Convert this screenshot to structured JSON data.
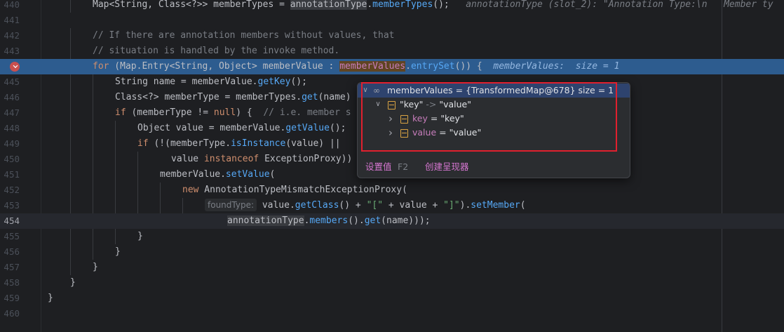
{
  "editor": {
    "lines": [
      {
        "n": "440",
        "indent": 2,
        "mode": "plain",
        "tokens": [
          {
            "t": "Map<String, Class<?>> memberTypes = "
          },
          {
            "t": "annotationType",
            "c": "hl"
          },
          {
            "t": "."
          },
          {
            "t": "memberTypes",
            "c": "fn"
          },
          {
            "t": "();   "
          },
          {
            "t": "annotationType (slot_2): \"Annotation Type:\\n   Member ty",
            "c": "inlay"
          }
        ]
      },
      {
        "n": "441",
        "indent": 0,
        "mode": "plain",
        "tokens": []
      },
      {
        "n": "442",
        "indent": 2,
        "mode": "plain",
        "tokens": [
          {
            "t": "// If there are annotation members without values, that",
            "c": "cm"
          }
        ]
      },
      {
        "n": "443",
        "indent": 2,
        "mode": "plain",
        "tokens": [
          {
            "t": "// situation is handled by the invoke method.",
            "c": "cm"
          }
        ]
      },
      {
        "n": "444",
        "indent": 2,
        "mode": "exec",
        "tokens": [
          {
            "t": "for",
            "c": "kw"
          },
          {
            "t": " (Map.Entry<String, Object> memberValue : "
          },
          {
            "t": "memberValues",
            "c": "fld hl-orange"
          },
          {
            "t": "."
          },
          {
            "t": "entrySet",
            "c": "fn"
          },
          {
            "t": "()) {  "
          },
          {
            "t": "memberValues:  size = 1",
            "c": "inlay-exec"
          }
        ]
      },
      {
        "n": "445",
        "indent": 3,
        "mode": "plain",
        "tokens": [
          {
            "t": "String name = memberValue."
          },
          {
            "t": "getKey",
            "c": "fn"
          },
          {
            "t": "();"
          }
        ]
      },
      {
        "n": "446",
        "indent": 3,
        "mode": "plain",
        "tokens": [
          {
            "t": "Class<?> memberType = memberTypes."
          },
          {
            "t": "get",
            "c": "fn"
          },
          {
            "t": "(name)"
          }
        ]
      },
      {
        "n": "447",
        "indent": 3,
        "mode": "plain",
        "tokens": [
          {
            "t": "if",
            "c": "kw"
          },
          {
            "t": " (memberType != "
          },
          {
            "t": "null",
            "c": "kw"
          },
          {
            "t": ") {  "
          },
          {
            "t": "// i.e. member s",
            "c": "cm"
          }
        ]
      },
      {
        "n": "448",
        "indent": 4,
        "mode": "plain",
        "tokens": [
          {
            "t": "Object value = memberValue."
          },
          {
            "t": "getValue",
            "c": "fn"
          },
          {
            "t": "();"
          }
        ]
      },
      {
        "n": "449",
        "indent": 4,
        "mode": "plain",
        "tokens": [
          {
            "t": "if",
            "c": "kw"
          },
          {
            "t": " (!(memberType."
          },
          {
            "t": "isInstance",
            "c": "fn"
          },
          {
            "t": "(value) ||"
          }
        ]
      },
      {
        "n": "450",
        "indent": 5.5,
        "mode": "plain",
        "tokens": [
          {
            "t": "value "
          },
          {
            "t": "instanceof",
            "c": "kw"
          },
          {
            "t": " ExceptionProxy))"
          }
        ]
      },
      {
        "n": "451",
        "indent": 5,
        "mode": "plain",
        "tokens": [
          {
            "t": "memberValue."
          },
          {
            "t": "setValue",
            "c": "fn"
          },
          {
            "t": "("
          }
        ]
      },
      {
        "n": "452",
        "indent": 6,
        "mode": "plain",
        "tokens": [
          {
            "t": "new",
            "c": "kw"
          },
          {
            "t": " AnnotationTypeMismatchExceptionProxy("
          }
        ]
      },
      {
        "n": "453",
        "indent": 7,
        "mode": "plain",
        "tokens": [
          {
            "t": "foundType:",
            "c": "hint"
          },
          {
            "t": " value."
          },
          {
            "t": "getClass",
            "c": "fn"
          },
          {
            "t": "() + "
          },
          {
            "t": "\"[\"",
            "c": "str"
          },
          {
            "t": " + value + "
          },
          {
            "t": "\"]\"",
            "c": "str"
          },
          {
            "t": ")."
          },
          {
            "t": "setMember",
            "c": "fn"
          },
          {
            "t": "("
          }
        ]
      },
      {
        "n": "454",
        "indent": 8,
        "mode": "current",
        "tokens": [
          {
            "t": "annotationType",
            "c": "hl"
          },
          {
            "t": "."
          },
          {
            "t": "members",
            "c": "fn"
          },
          {
            "t": "()."
          },
          {
            "t": "get",
            "c": "fn"
          },
          {
            "t": "(name)));"
          }
        ]
      },
      {
        "n": "455",
        "indent": 4,
        "mode": "plain",
        "tokens": [
          {
            "t": "}"
          }
        ]
      },
      {
        "n": "456",
        "indent": 3,
        "mode": "plain",
        "tokens": [
          {
            "t": "}"
          }
        ]
      },
      {
        "n": "457",
        "indent": 2,
        "mode": "plain",
        "tokens": [
          {
            "t": "}"
          }
        ]
      },
      {
        "n": "458",
        "indent": 1,
        "mode": "plain",
        "tokens": [
          {
            "t": "}"
          }
        ]
      },
      {
        "n": "459",
        "indent": 0,
        "mode": "plain",
        "tokens": [
          {
            "t": "}"
          }
        ]
      },
      {
        "n": "460",
        "indent": 0,
        "mode": "plain",
        "tokens": []
      }
    ]
  },
  "popup": {
    "rows": [
      {
        "level": 0,
        "chevron": "down",
        "icon": "infinity-icon",
        "name": "memberValues",
        "eq": " = ",
        "value": "{TransformedMap@678}",
        "extra": "  size = 1",
        "selected": true
      },
      {
        "level": 1,
        "chevron": "down",
        "icon": "field-icon",
        "name": "\"key\"",
        "arrow": " -> ",
        "value": "\"value\"",
        "selected": false
      },
      {
        "level": 2,
        "chevron": "right",
        "icon": "field-icon",
        "name": "key",
        "eq": " = ",
        "value": "\"key\"",
        "selected": false
      },
      {
        "level": 2,
        "chevron": "right",
        "icon": "field-icon",
        "name": "value",
        "eq": " = ",
        "value": "\"value\"",
        "selected": false
      }
    ],
    "footer": {
      "set_value_label": "设置值",
      "set_value_shortcut": "F2",
      "create_renderer_label": "创建呈现器"
    }
  },
  "colors": {
    "background": "#1e1f22",
    "exec_line": "#2d5c8f",
    "highlight_box": "#e0202e",
    "keyword": "#cf8e6d",
    "method": "#56a8f5",
    "comment": "#7a7e85",
    "field": "#c77dbb",
    "string": "#6aab73"
  }
}
